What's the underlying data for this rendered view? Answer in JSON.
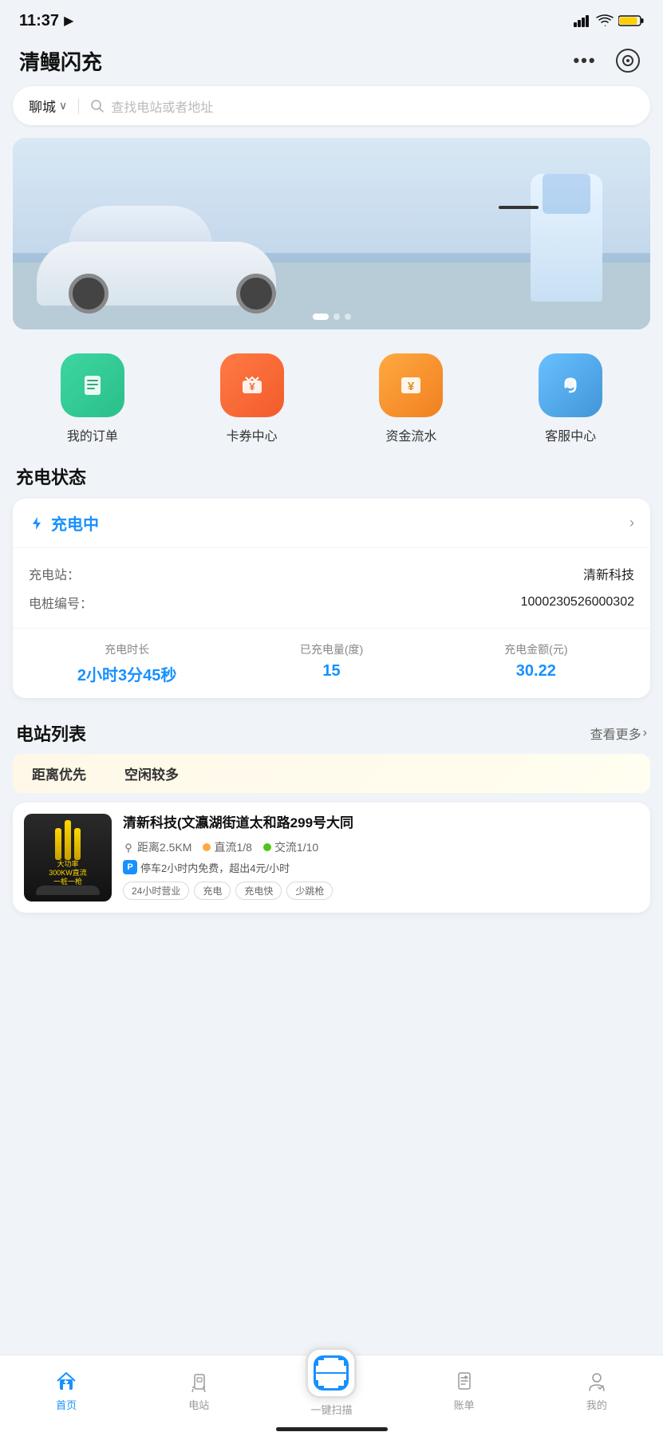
{
  "statusBar": {
    "time": "11:37",
    "locationArrow": "▶"
  },
  "header": {
    "title": "清鳗闪充",
    "moreBtn": "•••",
    "scanBtn": "⊙"
  },
  "searchBar": {
    "location": "聊城",
    "placeholder": "查找电站或者地址"
  },
  "quickActions": [
    {
      "id": "orders",
      "iconClass": "icon-orders",
      "icon": "📋",
      "label": "我的订单"
    },
    {
      "id": "cards",
      "iconClass": "icon-cards",
      "icon": "🎫",
      "label": "卡券中心"
    },
    {
      "id": "funds",
      "iconClass": "icon-funds",
      "icon": "¥",
      "label": "资金流水"
    },
    {
      "id": "service",
      "iconClass": "icon-service",
      "icon": "🎧",
      "label": "客服中心"
    }
  ],
  "chargingSection": {
    "title": "充电状态",
    "statusLabel": "充电中",
    "stationLabel": "充电站：",
    "stationName": "清新科技",
    "pileLabel": "电桩编号：",
    "pileNumber": "1000230526000302",
    "stats": [
      {
        "label": "充电时长",
        "value": "2小时3分45秒"
      },
      {
        "label": "已充电量(度)",
        "value": "15"
      },
      {
        "label": "充电金额(元)",
        "value": "30.22"
      }
    ]
  },
  "stationList": {
    "title": "电站列表",
    "moreText": "查看更多",
    "filters": [
      "距离优先",
      "空闲较多"
    ],
    "activeFilter": 0,
    "stations": [
      {
        "name": "清新科技(文瀛湖街道太和路299号大同",
        "distance": "距离2.5KM",
        "dcInfo": "直流1/8",
        "acInfo": "交流1/10",
        "parking": "停车2小时内免费，超出4元/小时",
        "tags": [
          "24小时营业",
          "充电",
          "充电快",
          "少跳枪"
        ]
      }
    ]
  },
  "bottomNav": {
    "items": [
      {
        "id": "home",
        "icon": "⚡",
        "label": "首页",
        "active": true
      },
      {
        "id": "station",
        "icon": "🔌",
        "label": "电站",
        "active": false
      },
      {
        "id": "scan",
        "icon": "scan",
        "label": "一键扫描",
        "active": false
      },
      {
        "id": "bill",
        "icon": "📄",
        "label": "账单",
        "active": false
      },
      {
        "id": "mine",
        "icon": "👤",
        "label": "我的",
        "active": false
      }
    ]
  },
  "colors": {
    "primary": "#1890ff",
    "accent": "#52c41a",
    "orange": "#ffa940",
    "green": "#52c41a"
  }
}
